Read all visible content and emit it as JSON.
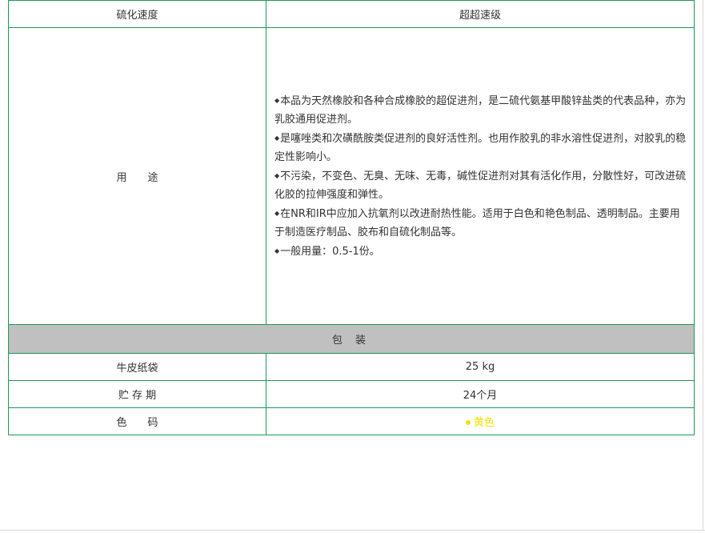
{
  "table": {
    "header": {
      "label": "硫化速度",
      "value": "超超速级"
    },
    "usage": {
      "label": "用　　途",
      "lines": [
        "本品为天然橡胶和各种合成橡胶的超促进剂，是二硫代氨基甲酸锌盐类的代表品种，亦为乳胶通用促进剂。",
        "是噻唑类和次磺酰胺类促进剂的良好活性剂。也用作胶乳的非水溶性促进剂，对胶乳的稳定性影响小。",
        "不污染，不变色、无臭、无味、无毒，碱性促进剂对其有活化作用，分散性好，可改进硫化胶的拉伸强度和弹性。",
        "在NR和IR中应加入抗氧剂以改进耐热性能。适用于白色和艳色制品、透明制品。主要用于制造医疗制品、胶布和自硫化制品等。",
        "一般用量：0.5-1份。"
      ],
      "bullet": "◆"
    },
    "packaging_title": "包 装",
    "rows": [
      {
        "label": "牛皮纸袋",
        "value": "25 kg"
      },
      {
        "label": "贮 存 期",
        "value": "24个月"
      },
      {
        "label": "色　　码",
        "value": "黄色",
        "value_color": "#f3e100"
      }
    ]
  }
}
